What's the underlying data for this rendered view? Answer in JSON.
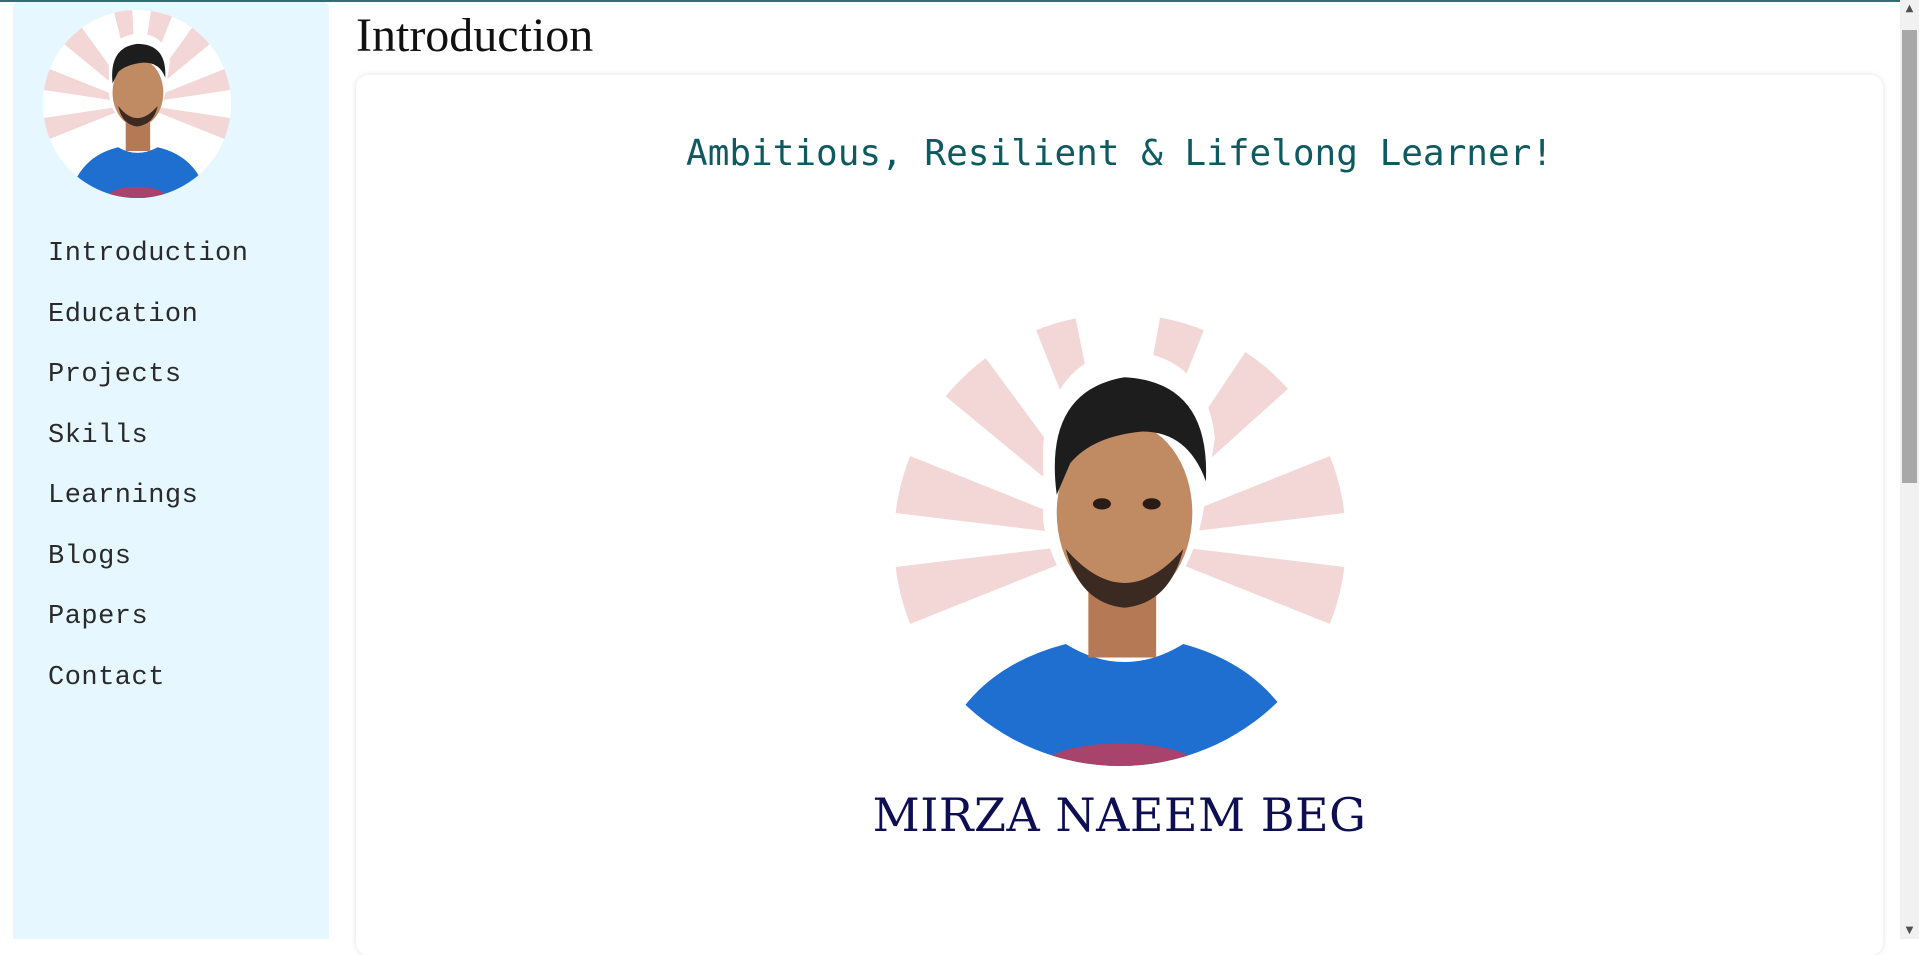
{
  "sidebar": {
    "nav_items": [
      {
        "label": "Introduction"
      },
      {
        "label": "Education"
      },
      {
        "label": "Projects"
      },
      {
        "label": "Skills"
      },
      {
        "label": "Learnings"
      },
      {
        "label": "Blogs"
      },
      {
        "label": "Papers"
      },
      {
        "label": "Contact"
      }
    ]
  },
  "main": {
    "title": "Introduction",
    "tagline": "Ambitious, Resilient & Lifelong Learner!",
    "name": "MIRZA NAEEM BEG"
  },
  "colors": {
    "sidebar_bg": "#e6f7ff",
    "tagline": "#0e5a61",
    "name": "#0d0f52",
    "shirt": "#1e6fd0",
    "sunburst": "#f3d6d6"
  },
  "icons": {
    "profile_photo": "profile-photo",
    "scroll_up": "scroll-up-arrow-icon",
    "scroll_down": "scroll-down-arrow-icon"
  }
}
